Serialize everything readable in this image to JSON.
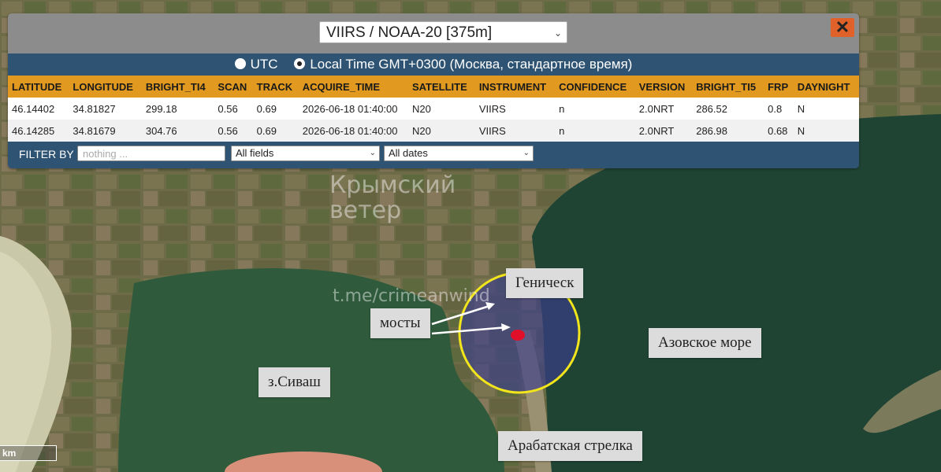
{
  "panel": {
    "satellite_select": "VIIRS / NOAA-20 [375m]",
    "close_glyph": "✕",
    "time_options": {
      "utc": "UTC",
      "local": "Local Time GMT+0300 (Москва, стандартное время)",
      "selected": "local"
    },
    "columns": [
      "LATITUDE",
      "LONGITUDE",
      "BRIGHT_TI4",
      "SCAN",
      "TRACK",
      "ACQUIRE_TIME",
      "SATELLITE",
      "INSTRUMENT",
      "CONFIDENCE",
      "VERSION",
      "BRIGHT_TI5",
      "FRP",
      "DAYNIGHT"
    ],
    "rows": [
      [
        "46.14402",
        "34.81827",
        "299.18",
        "0.56",
        "0.69",
        "2026-06-18 01:40:00",
        "N20",
        "VIIRS",
        "n",
        "2.0NRT",
        "286.52",
        "0.8",
        "N"
      ],
      [
        "46.14285",
        "34.81679",
        "304.76",
        "0.56",
        "0.69",
        "2026-06-18 01:40:00",
        "N20",
        "VIIRS",
        "n",
        "2.0NRT",
        "286.98",
        "0.68",
        "N"
      ]
    ],
    "filter": {
      "label": "FILTER BY",
      "placeholder": "nothing ...",
      "fields_select": "All fields",
      "dates_select": "All dates"
    }
  },
  "map": {
    "labels": {
      "genichesk": "Геническ",
      "bridges": "мосты",
      "azov_sea": "Азовское море",
      "sivash": "з.Сиваш",
      "arabat": "Арабатская стрелка"
    },
    "watermark": {
      "line1": "Крымский",
      "line2": "ветер",
      "channel": "t.me/crimeanwind"
    },
    "scale_unit": "km",
    "colors": {
      "sea": "#1c3f2f",
      "land": "#6e6b48",
      "hotspot": "#e0102a",
      "highlight_ring": "#f2e51c",
      "highlight_fill": "#3a3d8c"
    }
  }
}
